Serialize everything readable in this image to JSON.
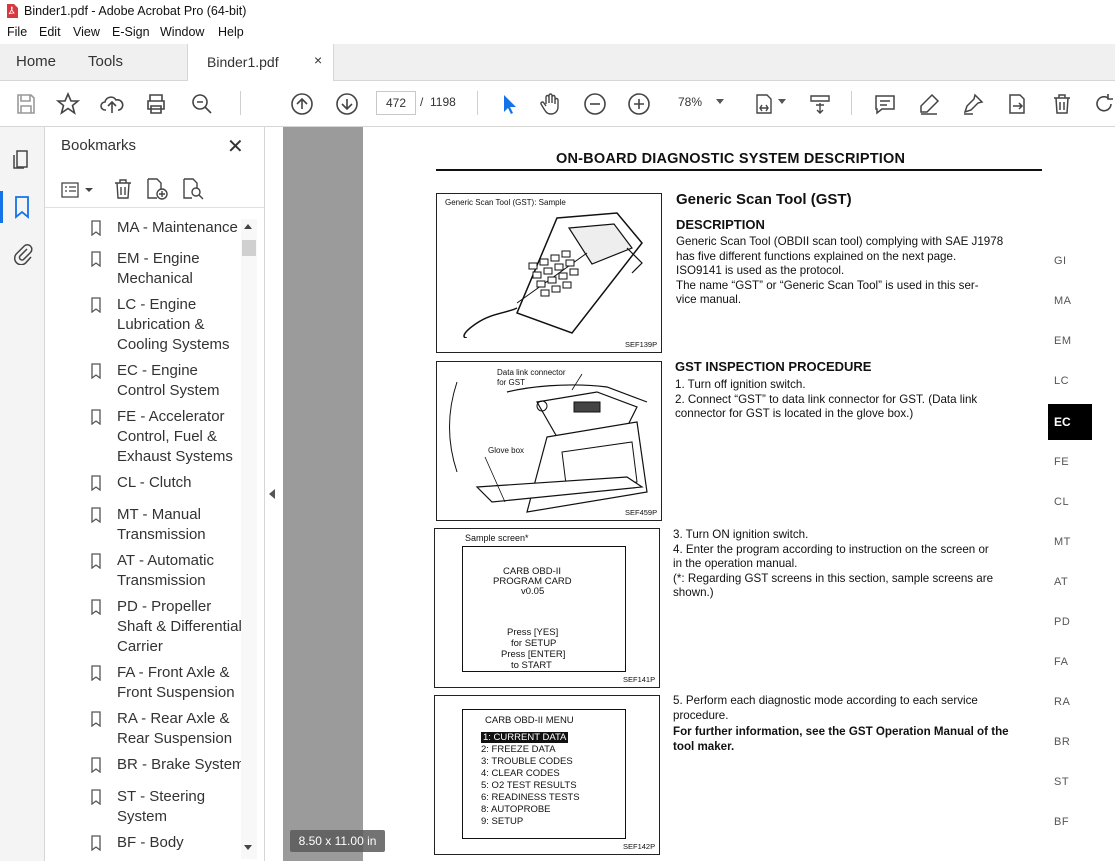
{
  "window": {
    "title": "Binder1.pdf - Adobe Acrobat Pro (64-bit)"
  },
  "menu": [
    "File",
    "Edit",
    "View",
    "E-Sign",
    "Window",
    "Help"
  ],
  "nav": {
    "home": "Home",
    "tools": "Tools"
  },
  "tab": {
    "label": "Binder1.pdf",
    "close": "×"
  },
  "toolbar": {
    "page_current": "472",
    "page_sep": "/",
    "page_total": "1198",
    "zoom": "78%"
  },
  "bookmarks": {
    "title": "Bookmarks",
    "close": "✕",
    "items": [
      "MA - Maintenance",
      "EM - Engine Mechanical",
      "LC - Engine Lubrication & Cooling Systems",
      "EC - Engine Control System",
      "FE - Accelerator Control, Fuel & Exhaust Systems",
      "CL - Clutch",
      "MT - Manual Transmission",
      "AT - Automatic Transmission",
      "PD - Propeller Shaft & Differential Carrier",
      "FA - Front Axle & Front Suspension",
      "RA - Rear Axle & Rear Suspension",
      "BR - Brake System",
      "ST - Steering System",
      "BF - Body"
    ]
  },
  "page_size": "8.50 x 11.00 in",
  "document": {
    "heading": "ON-BOARD DIAGNOSTIC SYSTEM DESCRIPTION",
    "fig1": {
      "caption": "Generic Scan Tool (GST): Sample",
      "code": "SEF139P"
    },
    "fig2": {
      "label1": "Data link connector",
      "label2": "for GST",
      "label3": "Glove box",
      "code": "SEF459P"
    },
    "fig3": {
      "caption": "Sample screen*",
      "lines": [
        "CARB OBD-II",
        "PROGRAM CARD",
        "v0.05",
        "Press [YES]",
        "for SETUP",
        "Press [ENTER]",
        "to START"
      ],
      "code": "SEF141P"
    },
    "fig4": {
      "title": "CARB OBD-II MENU",
      "items": [
        "1: CURRENT DATA",
        "2: FREEZE DATA",
        "3: TROUBLE CODES",
        "4: CLEAR CODES",
        "5: O2 TEST RESULTS",
        "6: READINESS TESTS",
        "8: AUTOPROBE",
        "9: SETUP"
      ],
      "code": "SEF142P"
    },
    "gst_title": "Generic Scan Tool (GST)",
    "desc_heading": "DESCRIPTION",
    "desc_lines": [
      "Generic Scan Tool (OBDII scan tool) complying with SAE J1978",
      "has five different functions explained on the next page.",
      "ISO9141 is used as the protocol.",
      "The name “GST” or “Generic Scan Tool” is used in this ser-",
      "vice manual."
    ],
    "proc_heading": "GST INSPECTION PROCEDURE",
    "steps_a": [
      "1.   Turn off ignition switch.",
      "2.   Connect “GST” to data link connector for GST. (Data link",
      "       connector for GST is located in the glove box.)"
    ],
    "steps_b": [
      "3.   Turn ON ignition switch.",
      "4.   Enter the program according to instruction on the screen or",
      "       in the operation manual.",
      "(*: Regarding GST screens in this section, sample screens are",
      "shown.)"
    ],
    "steps_c": [
      "5.   Perform each diagnostic mode according to each service",
      "       procedure."
    ],
    "note_lines": [
      "For further information, see the GST Operation Manual of the",
      "tool maker."
    ]
  },
  "index_tabs": [
    "GI",
    "MA",
    "EM",
    "LC",
    "EC",
    "FE",
    "CL",
    "MT",
    "AT",
    "PD",
    "FA",
    "RA",
    "BR",
    "ST",
    "BF"
  ],
  "active_index": "EC",
  "colors": {
    "accent": "#1473e6",
    "pdf_red": "#d7373f"
  }
}
